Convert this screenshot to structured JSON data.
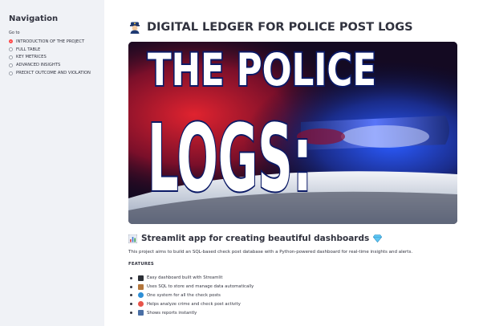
{
  "sidebar": {
    "title": "Navigation",
    "goto_label": "Go to",
    "options": [
      {
        "label": "INTRODUCTION OF THE PROJECT",
        "selected": true
      },
      {
        "label": "FULL TABLE",
        "selected": false
      },
      {
        "label": "KEY METRICES",
        "selected": false
      },
      {
        "label": "ADVANCED INSIGHTS",
        "selected": false
      },
      {
        "label": "PREDICT OUTCOME AND VIOLATION",
        "selected": false
      }
    ]
  },
  "main": {
    "title": "DIGITAL LEDGER FOR POLICE POST LOGS",
    "title_icon": "police-officer-icon",
    "hero": {
      "line1": "THE POLICE",
      "line2": "LOGS:"
    },
    "section_heading": "Streamlit app for creating beautiful dashboards",
    "section_icon": "bar-chart-icon",
    "section_trailing_icon": "gem-icon",
    "intro": "This project aims to build an SQL-based check post database with a Python-powered dashboard for real-time insights and alerts.",
    "features_label": "FEATURES",
    "features": [
      {
        "icon": "desktop-icon",
        "text": "Easy dashboard built with Streamlit",
        "color": "#2b2f36"
      },
      {
        "icon": "package-icon",
        "text": "Uses SQL to store and manage data automatically",
        "color": "#b4773c"
      },
      {
        "icon": "globe-icon",
        "text": "One system for all the check posts",
        "color": "#2e8fd6"
      },
      {
        "icon": "no-entry-icon",
        "text": "Helps analyze crime and check post activity",
        "color": "#e8544a"
      },
      {
        "icon": "chart-icon",
        "text": "Shows reports instantly",
        "color": "#4a6fa5"
      }
    ]
  },
  "colors": {
    "accent": "#ff4b4b",
    "sidebar_bg": "#f0f2f6",
    "text": "#31333f"
  }
}
